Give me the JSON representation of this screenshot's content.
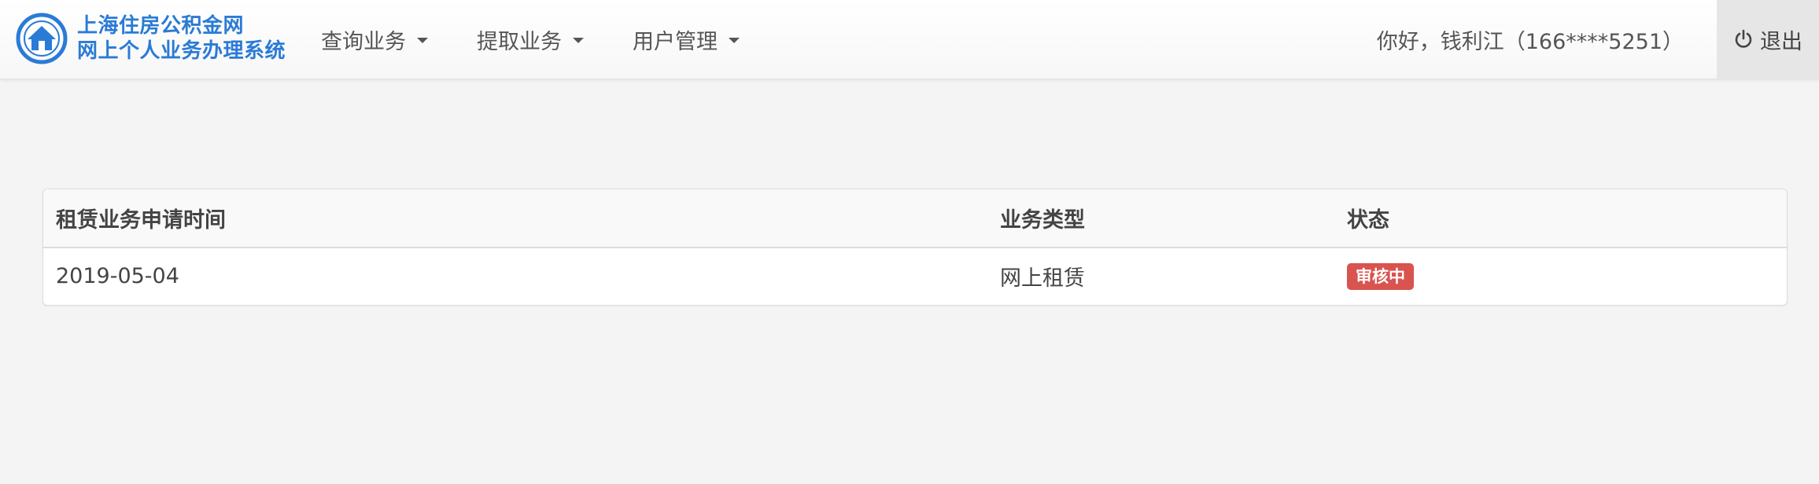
{
  "brand": {
    "line1": "上海住房公积金网",
    "line2": "网上个人业务办理系统",
    "logo_icon": "house-circle-logo",
    "color": "#2a7bd6"
  },
  "nav": {
    "items": [
      {
        "label": "查询业务",
        "icon": "caret-down-icon"
      },
      {
        "label": "提取业务",
        "icon": "caret-down-icon"
      },
      {
        "label": "用户管理",
        "icon": "caret-down-icon"
      }
    ]
  },
  "user": {
    "greeting": "你好，钱利江（166****5251）"
  },
  "logout": {
    "label": "退出",
    "icon": "power-icon"
  },
  "table": {
    "headers": [
      "租赁业务申请时间",
      "业务类型",
      "状态"
    ],
    "rows": [
      {
        "date": "2019-05-04",
        "type": "网上租赁",
        "status": "审核中"
      }
    ]
  },
  "colors": {
    "status_badge": "#d9534f",
    "page_background": "#f4f4f4"
  }
}
